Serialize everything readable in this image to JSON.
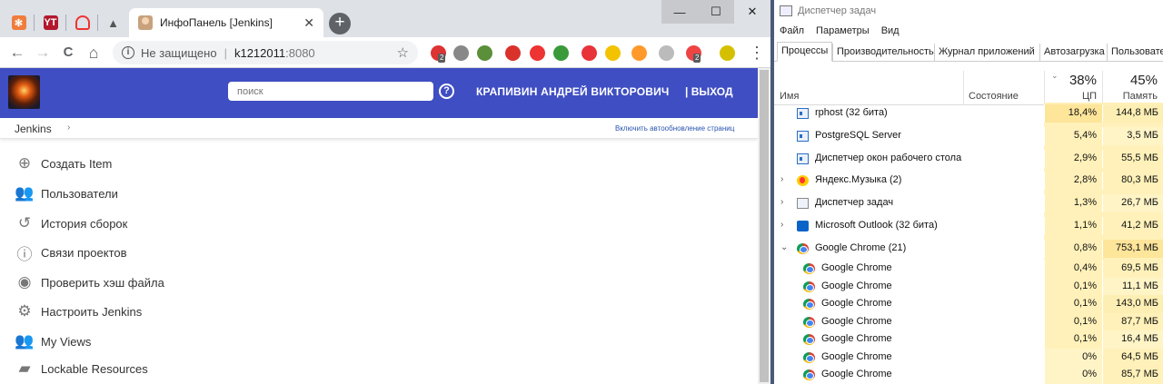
{
  "chrome": {
    "active_tab_title": "ИнфоПанель [Jenkins]",
    "tab_close_glyph": "✕",
    "new_tab_glyph": "+",
    "mini_tabs": [
      {
        "icon": "tab-icon-orange",
        "color": "#f07d3c"
      },
      {
        "icon": "tab-icon-yt",
        "color": "#b3182f"
      },
      {
        "icon": "tab-icon-red-outline",
        "color": "#ffffff"
      },
      {
        "icon": "tab-icon-delta",
        "color": "#d9d9d9"
      }
    ],
    "window_buttons": {
      "minimize": "—",
      "maximize": "☐",
      "close": "✕"
    },
    "nav": {
      "back": "←",
      "forward": "→",
      "reload": "C",
      "home": "⌂"
    },
    "omnibox": {
      "security_label": "Не защищено",
      "host": "k1212011",
      "port": ":8080"
    },
    "extensions": [
      {
        "name": "ext-red-badge",
        "color": "#d33",
        "badge": "2"
      },
      {
        "name": "ext-pocket",
        "color": "#888"
      },
      {
        "name": "ext-image",
        "color": "#5b8f3a"
      },
      {
        "name": "ext-adblock",
        "color": "#d9322b"
      },
      {
        "name": "ext-cloud",
        "color": "#e33"
      },
      {
        "name": "ext-green",
        "color": "#3a9a3a"
      },
      {
        "name": "ext-target",
        "color": "#e8333a"
      },
      {
        "name": "ext-yellow-i",
        "color": "#f3c300"
      },
      {
        "name": "ext-fox",
        "color": "#ff9a2a"
      },
      {
        "name": "ext-sphere",
        "color": "#bbb"
      },
      {
        "name": "ext-mail",
        "color": "#e44",
        "badge": "2"
      },
      {
        "name": "ext-avatar",
        "color": "#d4c000"
      }
    ]
  },
  "jenkins": {
    "search_placeholder": "поиск",
    "help_glyph": "?",
    "user": "КРАПИВИН АНДРЕЙ ВИКТОРОВИЧ",
    "logout": "| ВЫХОД",
    "breadcrumb": "Jenkins",
    "breadcrumb_arrow": "›",
    "autorefresh": "Включить автообновление страниц",
    "tasks": [
      {
        "label": "Создать Item",
        "icon": "plus-circle-icon",
        "glyph": "⊕"
      },
      {
        "label": "Пользователи",
        "icon": "users-icon",
        "glyph": "👥"
      },
      {
        "label": "История сборок",
        "icon": "history-icon",
        "glyph": "↺"
      },
      {
        "label": "Связи проектов",
        "icon": "info-icon",
        "glyph": "ⓘ"
      },
      {
        "label": "Проверить хэш файла",
        "icon": "fingerprint-icon",
        "glyph": "◉"
      },
      {
        "label": "Настроить Jenkins",
        "icon": "gear-icon",
        "glyph": "⚙"
      },
      {
        "label": "My Views",
        "icon": "users-icon",
        "glyph": "👥"
      },
      {
        "label": "Lockable Resources",
        "icon": "usb-icon",
        "glyph": "▰"
      }
    ]
  },
  "taskmgr": {
    "title": "Диспетчер задач",
    "menu": [
      "Файл",
      "Параметры",
      "Вид"
    ],
    "tabs": [
      "Процессы",
      "Производительность",
      "Журнал приложений",
      "Автозагрузка",
      "Пользовате"
    ],
    "columns": {
      "name": "Имя",
      "state": "Состояние",
      "cpu_pct": "38%",
      "cpu": "ЦП",
      "mem_pct": "45%",
      "mem": "Память"
    },
    "rows": [
      {
        "expand": "",
        "icon": "win",
        "name": "rphost (32 бита)",
        "cpu": "18,4%",
        "mem": "144,8 МБ",
        "child": false,
        "cpu_bg": "#fde59a",
        "mem_bg": "#fdefb4"
      },
      {
        "expand": "",
        "icon": "win",
        "name": "PostgreSQL Server",
        "cpu": "5,4%",
        "mem": "3,5 МБ",
        "child": false,
        "cpu_bg": "#fff1b9",
        "mem_bg": "#fff4c6"
      },
      {
        "expand": "",
        "icon": "win",
        "name": "Диспетчер окон рабочего стола",
        "cpu": "2,9%",
        "mem": "55,5 МБ",
        "child": false,
        "cpu_bg": "#fff1b9",
        "mem_bg": "#fff1b9"
      },
      {
        "expand": "›",
        "icon": "yamusic",
        "name": "Яндекс.Музыка (2)",
        "cpu": "2,8%",
        "mem": "80,3 МБ",
        "child": false,
        "cpu_bg": "#fff1b9",
        "mem_bg": "#fff1b9"
      },
      {
        "expand": "›",
        "icon": "tm",
        "name": "Диспетчер задач",
        "cpu": "1,3%",
        "mem": "26,7 МБ",
        "child": false,
        "cpu_bg": "#fff1b9",
        "mem_bg": "#fff4c6"
      },
      {
        "expand": "›",
        "icon": "outlook",
        "name": "Microsoft Outlook (32 бита)",
        "cpu": "1,1%",
        "mem": "41,2 МБ",
        "child": false,
        "cpu_bg": "#fff1b9",
        "mem_bg": "#fff1b9"
      },
      {
        "expand": "⌄",
        "icon": "chrome",
        "name": "Google Chrome (21)",
        "cpu": "0,8%",
        "mem": "753,1 МБ",
        "child": false,
        "cpu_bg": "#fff1b9",
        "mem_bg": "#fde59a"
      },
      {
        "expand": "",
        "icon": "chrome",
        "name": "Google Chrome",
        "cpu": "0,4%",
        "mem": "69,5 МБ",
        "child": true,
        "cpu_bg": "#fff1b9",
        "mem_bg": "#fff1b9"
      },
      {
        "expand": "",
        "icon": "chrome",
        "name": "Google Chrome",
        "cpu": "0,1%",
        "mem": "11,1 МБ",
        "child": true,
        "cpu_bg": "#fff1b9",
        "mem_bg": "#fff4c6"
      },
      {
        "expand": "",
        "icon": "chrome",
        "name": "Google Chrome",
        "cpu": "0,1%",
        "mem": "143,0 МБ",
        "child": true,
        "cpu_bg": "#fff1b9",
        "mem_bg": "#fdefb4"
      },
      {
        "expand": "",
        "icon": "chrome",
        "name": "Google Chrome",
        "cpu": "0,1%",
        "mem": "87,7 МБ",
        "child": true,
        "cpu_bg": "#fff1b9",
        "mem_bg": "#fff1b9"
      },
      {
        "expand": "",
        "icon": "chrome",
        "name": "Google Chrome",
        "cpu": "0,1%",
        "mem": "16,4 МБ",
        "child": true,
        "cpu_bg": "#fff1b9",
        "mem_bg": "#fff4c6"
      },
      {
        "expand": "",
        "icon": "chrome",
        "name": "Google Chrome",
        "cpu": "0%",
        "mem": "64,5 МБ",
        "child": true,
        "cpu_bg": "#fff4c6",
        "mem_bg": "#fff1b9"
      },
      {
        "expand": "",
        "icon": "chrome",
        "name": "Google Chrome",
        "cpu": "0%",
        "mem": "85,7 МБ",
        "child": true,
        "cpu_bg": "#fff4c6",
        "mem_bg": "#fff1b9"
      }
    ]
  }
}
